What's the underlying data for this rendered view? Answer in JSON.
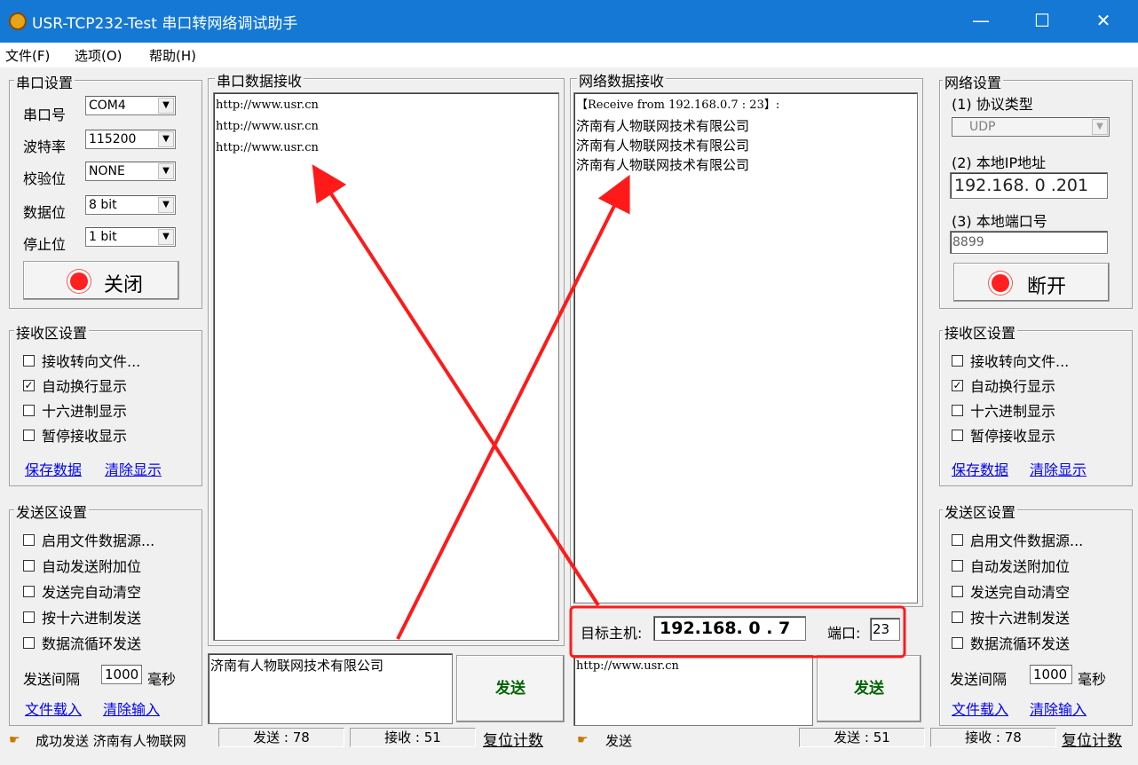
{
  "window": {
    "title": "USR-TCP232-Test 串口转网络调试助手",
    "minimize": "—",
    "maximize": "☐",
    "close": "✕"
  },
  "menu": {
    "file": "文件(F)",
    "options": "选项(O)",
    "help": "帮助(H)"
  },
  "serial_settings": {
    "title": "串口设置",
    "port_label": "串口号",
    "port_value": "COM4",
    "baud_label": "波特率",
    "baud_value": "115200",
    "parity_label": "校验位",
    "parity_value": "NONE",
    "databits_label": "数据位",
    "databits_value": "8 bit",
    "stopbits_label": "停止位",
    "stopbits_value": "1 bit",
    "toggle_button": "关闭"
  },
  "left_recv_settings": {
    "title": "接收区设置",
    "options": [
      {
        "label": "接收转向文件...",
        "checked": false
      },
      {
        "label": "自动换行显示",
        "checked": true
      },
      {
        "label": "十六进制显示",
        "checked": false
      },
      {
        "label": "暂停接收显示",
        "checked": false
      }
    ],
    "save_link": "保存数据",
    "clear_link": "清除显示"
  },
  "left_send_settings": {
    "title": "发送区设置",
    "options": [
      {
        "label": "启用文件数据源...",
        "checked": false
      },
      {
        "label": "自动发送附加位",
        "checked": false
      },
      {
        "label": "发送完自动清空",
        "checked": false
      },
      {
        "label": "按十六进制发送",
        "checked": false
      },
      {
        "label": "数据流循环发送",
        "checked": false
      }
    ],
    "interval_label": "发送间隔",
    "interval_value": "1000",
    "interval_unit": "毫秒",
    "load_link": "文件载入",
    "clear_link": "清除输入"
  },
  "serial_receive": {
    "title": "串口数据接收",
    "lines": [
      "http://www.usr.cn",
      "http://www.usr.cn",
      "http://www.usr.cn"
    ]
  },
  "serial_send": {
    "text": "济南有人物联网技术有限公司",
    "button": "发送"
  },
  "network_receive": {
    "title": "网络数据接收",
    "lines": [
      "【Receive from 192.168.0.7 : 23】:",
      "济南有人物联网技术有限公司",
      "济南有人物联网技术有限公司",
      "济南有人物联网技术有限公司"
    ]
  },
  "target": {
    "host_label": "目标主机:",
    "host_value": "192.168. 0 . 7",
    "port_label": "端口:",
    "port_value": "23"
  },
  "network_send": {
    "text": "http://www.usr.cn",
    "button": "发送"
  },
  "network_settings": {
    "title": "网络设置",
    "protocol_label": "(1) 协议类型",
    "protocol_value": "UDP",
    "ip_label": "(2) 本地IP地址",
    "ip_value": "192.168. 0 .201",
    "port_label": "(3) 本地端口号",
    "port_value": "8899",
    "toggle_button": "断开"
  },
  "right_recv_settings": {
    "title": "接收区设置",
    "options": [
      {
        "label": "接收转向文件...",
        "checked": false
      },
      {
        "label": "自动换行显示",
        "checked": true
      },
      {
        "label": "十六进制显示",
        "checked": false
      },
      {
        "label": "暂停接收显示",
        "checked": false
      }
    ],
    "save_link": "保存数据",
    "clear_link": "清除显示"
  },
  "right_send_settings": {
    "title": "发送区设置",
    "options": [
      {
        "label": "启用文件数据源...",
        "checked": false
      },
      {
        "label": "自动发送附加位",
        "checked": false
      },
      {
        "label": "发送完自动清空",
        "checked": false
      },
      {
        "label": "按十六进制发送",
        "checked": false
      },
      {
        "label": "数据流循环发送",
        "checked": false
      }
    ],
    "interval_label": "发送间隔",
    "interval_value": "1000",
    "interval_unit": "毫秒",
    "load_link": "文件载入",
    "clear_link": "清除输入"
  },
  "status_left": {
    "message": "成功发送 济南有人物联网",
    "sent": "发送 : 78",
    "received": "接收 : 51",
    "reset": "复位计数"
  },
  "status_right": {
    "message": "发送",
    "sent": "发送 : 51",
    "received": "接收 : 78",
    "reset": "复位计数"
  },
  "colors": {
    "titlebar": "#1478d4",
    "annotation": "#ff1a1a",
    "link": "#0000ee",
    "send_text": "#006400"
  }
}
